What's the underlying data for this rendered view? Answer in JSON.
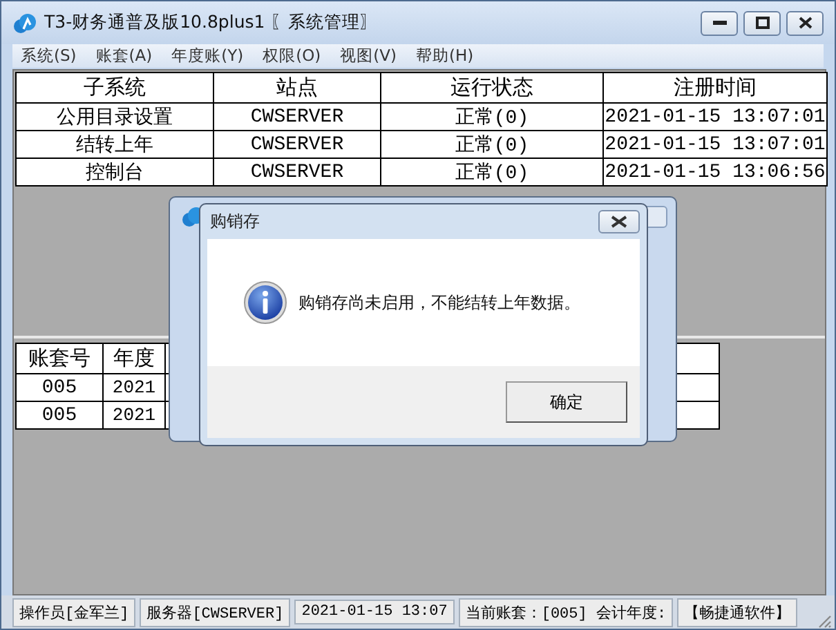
{
  "window": {
    "title": "T3-财务通普及版10.8plus1 〖系统管理〗"
  },
  "menu": [
    "系统(S)",
    "账套(A)",
    "年度账(Y)",
    "权限(O)",
    "视图(V)",
    "帮助(H)"
  ],
  "top_table": {
    "columns": [
      "子系统",
      "站点",
      "运行状态",
      "注册时间"
    ],
    "rows": [
      [
        "公用目录设置",
        "CWSERVER",
        "正常(0)",
        "2021-01-15 13:07:01"
      ],
      [
        "结转上年",
        "CWSERVER",
        "正常(0)",
        "2021-01-15 13:07:01"
      ],
      [
        "控制台",
        "CWSERVER",
        "正常(0)",
        "2021-01-15 13:06:56"
      ]
    ]
  },
  "bottom_table": {
    "columns": [
      "账套号",
      "年度"
    ],
    "rows": [
      [
        "005",
        "2021"
      ],
      [
        "005",
        "2021"
      ]
    ]
  },
  "dialog": {
    "title": "购销存",
    "message": "购销存尚未启用，不能结转上年数据。",
    "ok_button": "确定"
  },
  "status_bar": [
    "操作员[金军兰]",
    "服务器[CWSERVER]",
    "2021-01-15 13:07",
    "当前账套：[005] 会计年度:",
    "【畅捷通软件】"
  ]
}
